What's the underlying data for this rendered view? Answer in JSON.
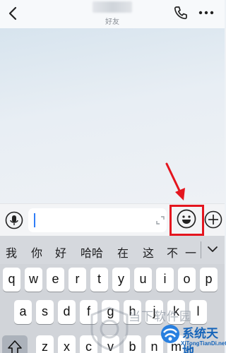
{
  "header": {
    "subtitle": "好友",
    "icons": [
      "back-arrow-icon",
      "phone-icon",
      "more-icon"
    ]
  },
  "input_bar": {
    "placeholder": "",
    "icons": [
      "microphone-icon",
      "expand-icon",
      "emoji-icon",
      "plus-icon"
    ]
  },
  "candidates": [
    "我",
    "你",
    "好",
    "哈哈",
    "在",
    "这",
    "不",
    "一"
  ],
  "keyboard": {
    "row1": [
      "q",
      "w",
      "e",
      "r",
      "t",
      "y",
      "u",
      "i",
      "o",
      "p"
    ],
    "row2": [
      "a",
      "s",
      "d",
      "f",
      "g",
      "h",
      "j",
      "k",
      "l"
    ],
    "row3": [
      "z",
      "x",
      "c",
      "v",
      "b",
      "n",
      "m"
    ]
  },
  "watermark": {
    "text": "当下软件园",
    "logo_cn": "系统天地",
    "logo_en": "XiTongTianDi.net"
  },
  "colors": {
    "highlight": "#e4151e",
    "caret": "#2f7df7",
    "logo": "#0d5fb8"
  }
}
